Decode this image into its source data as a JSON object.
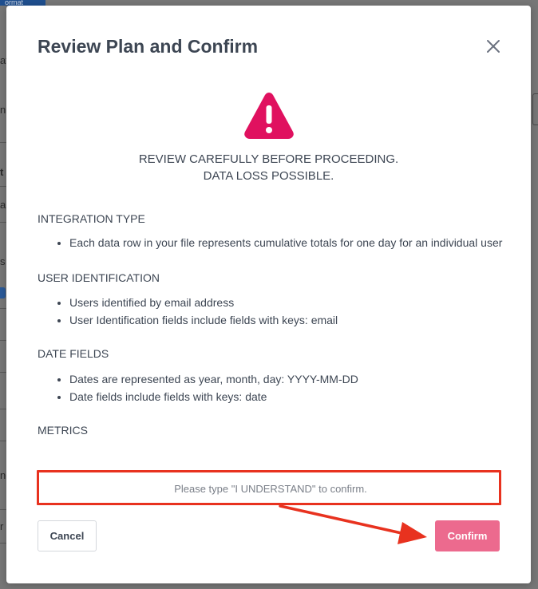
{
  "background": {
    "tab_label": "ormat",
    "fragments": [
      "at",
      "n",
      "t",
      "al",
      "s",
      "ne",
      "r"
    ]
  },
  "modal": {
    "title": "Review Plan and Confirm",
    "warning_line1": "REVIEW CAREFULLY BEFORE PROCEEDING.",
    "warning_line2": "DATA LOSS POSSIBLE.",
    "sections": [
      {
        "heading": "INTEGRATION TYPE",
        "items": [
          "Each data row in your file represents cumulative totals for one day for an individual user"
        ]
      },
      {
        "heading": "USER IDENTIFICATION",
        "items": [
          "Users identified by email address",
          "User Identification fields include fields with keys: email"
        ]
      },
      {
        "heading": "DATE FIELDS",
        "items": [
          "Dates are represented as year, month, day: YYYY-MM-DD",
          "Date fields include fields with keys: date"
        ]
      },
      {
        "heading": "METRICS",
        "items": []
      }
    ],
    "confirm_placeholder": "Please type \"I UNDERSTAND\" to confirm.",
    "confirm_value": "",
    "cancel_label": "Cancel",
    "confirm_label": "Confirm"
  },
  "colors": {
    "warning": "#e0115f",
    "annotation": "#e8321f",
    "confirm_button": "#ec6a8e",
    "text": "#3d4653"
  },
  "icons": {
    "close": "close-icon",
    "warning": "warning-triangle-icon",
    "arrow": "annotation-arrow"
  }
}
